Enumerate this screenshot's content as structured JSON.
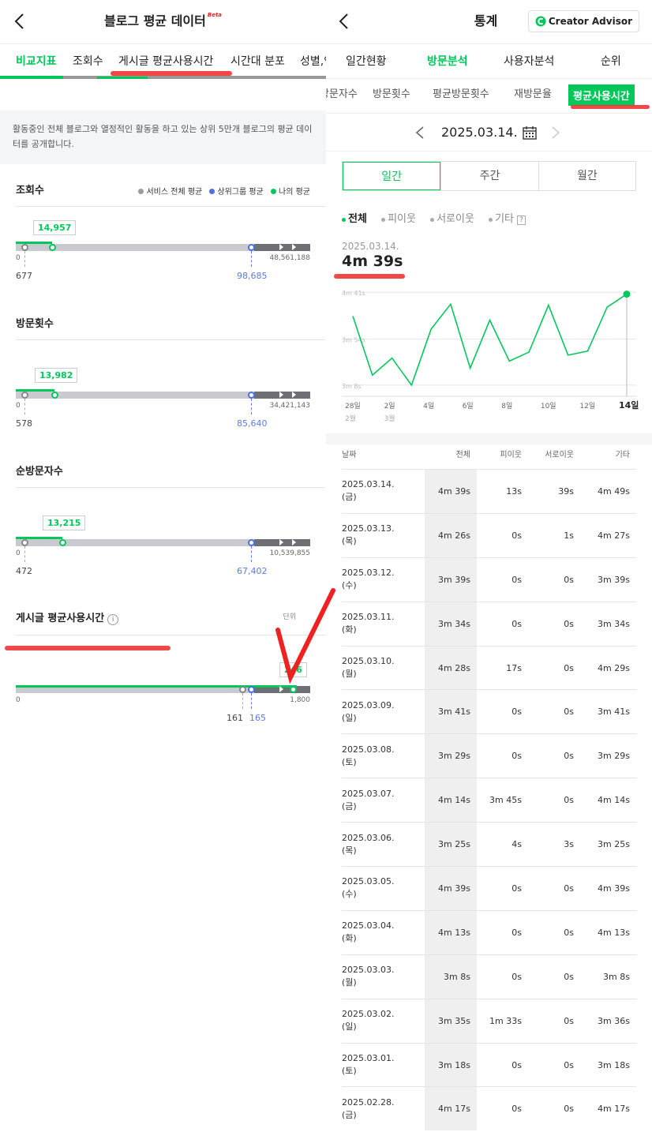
{
  "left": {
    "title": "블로그 평균 데이터",
    "beta": "Beta",
    "tabs": [
      "비교지표",
      "조회수",
      "게시글 평균사용시간",
      "시간대 분포",
      "성별,연"
    ],
    "notice": "활동중인 전체 블로그와 열정적인 활동을 하고 있는 상위 5만개 블로그의 평균 데이터를 공개합니다.",
    "legend": [
      "서비스 전체 평균",
      "상위그룹 평균",
      "나의 평균"
    ],
    "colors": {
      "service": "#9a9aa0",
      "top": "#4f6fe8",
      "mine": "#03c75a"
    },
    "metrics": [
      {
        "name": "조회수",
        "mine": "14,957",
        "service": "677",
        "top": "98,685",
        "min": "0",
        "max": "48,561,188"
      },
      {
        "name": "방문횟수",
        "mine": "13,982",
        "service": "578",
        "top": "85,640",
        "min": "0",
        "max": "34,421,143"
      },
      {
        "name": "순방문자수",
        "mine": "13,215",
        "service": "472",
        "top": "67,402",
        "min": "0",
        "max": "10,539,855"
      },
      {
        "name": "게시글 평균사용시간",
        "unit": "단위",
        "mine": "246",
        "service": "161",
        "top": "165",
        "min": "0",
        "max": "1,800"
      }
    ]
  },
  "right": {
    "title": "통계",
    "brand": "Creator Advisor",
    "tabs": [
      "일간현황",
      "방문분석",
      "사용자분석",
      "순위"
    ],
    "subtabs": [
      "순방문자수",
      "방문횟수",
      "평균방문횟수",
      "재방문율",
      "평균사용시간"
    ],
    "date": "2025.03.14.",
    "periods": [
      "일간",
      "주간",
      "월간"
    ],
    "filters": [
      "전체",
      "피이웃",
      "서로이웃",
      "기타"
    ],
    "help": "?",
    "current_date": "2025.03.14.",
    "current_value": "4m 39s",
    "chart_data": {
      "type": "line",
      "ylabels": [
        "4m 41s",
        "3m 54s",
        "3m 8s"
      ],
      "xlabels": [
        {
          "day": "28일",
          "month": "2월"
        },
        {
          "day": "2일",
          "month": "3월"
        },
        {
          "day": "4일",
          "month": ""
        },
        {
          "day": "6일",
          "month": ""
        },
        {
          "day": "8일",
          "month": ""
        },
        {
          "day": "10일",
          "month": ""
        },
        {
          "day": "12일",
          "month": ""
        },
        {
          "day": "14일",
          "month": ""
        }
      ],
      "series": [
        {
          "values": [
            257,
            198,
            215,
            188,
            244,
            269,
            205,
            253,
            212,
            221,
            268,
            218,
            222,
            266,
            279
          ]
        }
      ],
      "ylim": [
        180,
        285
      ]
    },
    "table": {
      "headers": [
        "날짜",
        "전체",
        "피이웃",
        "서로이웃",
        "기타"
      ],
      "rows": [
        [
          "2025.03.14.",
          "(금)",
          "4m 39s",
          "13s",
          "39s",
          "4m 49s"
        ],
        [
          "2025.03.13.",
          "(목)",
          "4m 26s",
          "0s",
          "1s",
          "4m 27s"
        ],
        [
          "2025.03.12.",
          "(수)",
          "3m 39s",
          "0s",
          "0s",
          "3m 39s"
        ],
        [
          "2025.03.11.",
          "(화)",
          "3m 34s",
          "0s",
          "0s",
          "3m 34s"
        ],
        [
          "2025.03.10.",
          "(월)",
          "4m 28s",
          "17s",
          "0s",
          "4m 29s"
        ],
        [
          "2025.03.09.",
          "(일)",
          "3m 41s",
          "0s",
          "0s",
          "3m 41s"
        ],
        [
          "2025.03.08.",
          "(토)",
          "3m 29s",
          "0s",
          "0s",
          "3m 29s"
        ],
        [
          "2025.03.07.",
          "(금)",
          "4m 14s",
          "3m 45s",
          "0s",
          "4m 14s"
        ],
        [
          "2025.03.06.",
          "(목)",
          "3m 25s",
          "4s",
          "3s",
          "3m 25s"
        ],
        [
          "2025.03.05.",
          "(수)",
          "4m 39s",
          "0s",
          "0s",
          "4m 39s"
        ],
        [
          "2025.03.04.",
          "(화)",
          "4m 13s",
          "0s",
          "0s",
          "4m 13s"
        ],
        [
          "2025.03.03.",
          "(월)",
          "3m 8s",
          "0s",
          "0s",
          "3m 8s"
        ],
        [
          "2025.03.02.",
          "(일)",
          "3m 35s",
          "1m 33s",
          "0s",
          "3m 36s"
        ],
        [
          "2025.03.01.",
          "(토)",
          "3m 18s",
          "0s",
          "0s",
          "3m 18s"
        ],
        [
          "2025.02.28.",
          "(금)",
          "4m 17s",
          "0s",
          "0s",
          "4m 17s"
        ]
      ]
    }
  }
}
